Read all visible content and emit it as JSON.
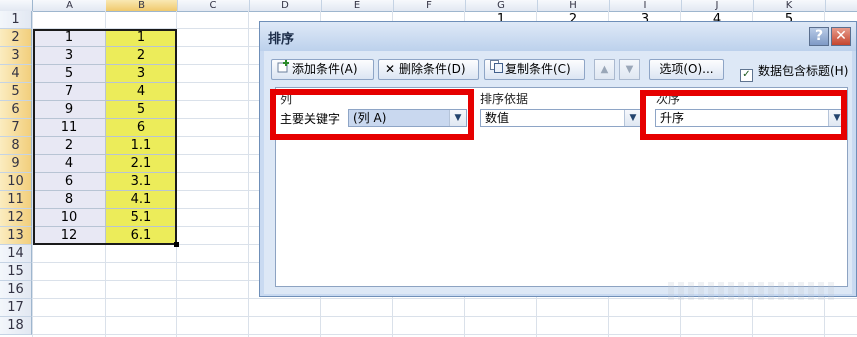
{
  "sheet": {
    "columns": [
      "A",
      "B",
      "C",
      "D",
      "E",
      "F",
      "G",
      "H",
      "I",
      "J",
      "K"
    ],
    "rows": [
      "1",
      "2",
      "3",
      "4",
      "5",
      "6",
      "7",
      "8",
      "9",
      "10",
      "11",
      "12",
      "13",
      "14",
      "15",
      "16",
      "17",
      "18"
    ],
    "col_a": [
      "1",
      "3",
      "5",
      "7",
      "9",
      "11",
      "2",
      "4",
      "6",
      "8",
      "10",
      "12"
    ],
    "col_b": [
      "1",
      "2",
      "3",
      "4",
      "5",
      "6",
      "1.1",
      "2.1",
      "3.1",
      "4.1",
      "5.1",
      "6.1"
    ],
    "row1_visible": [
      "1",
      "2",
      "3",
      "4",
      "5"
    ]
  },
  "dialog": {
    "title": "排序",
    "help_label": "?",
    "close_label": "✕",
    "add_condition": "添加条件(A)",
    "delete_condition": "删除条件(D)",
    "copy_condition": "复制条件(C)",
    "options": "选项(O)...",
    "header_checkbox": "数据包含标题(H)",
    "header_checked": true,
    "col_header": "列",
    "sortby_header": "排序依据",
    "order_header": "次序",
    "primary_key_label": "主要关键字",
    "primary_key_value": "(列 A)",
    "sort_on_value": "数值",
    "order_value": "升序"
  },
  "colors": {
    "highlight_red": "#e60000",
    "column_b_fill": "#ecec5a",
    "dialog_bg": "#dde8f6"
  }
}
